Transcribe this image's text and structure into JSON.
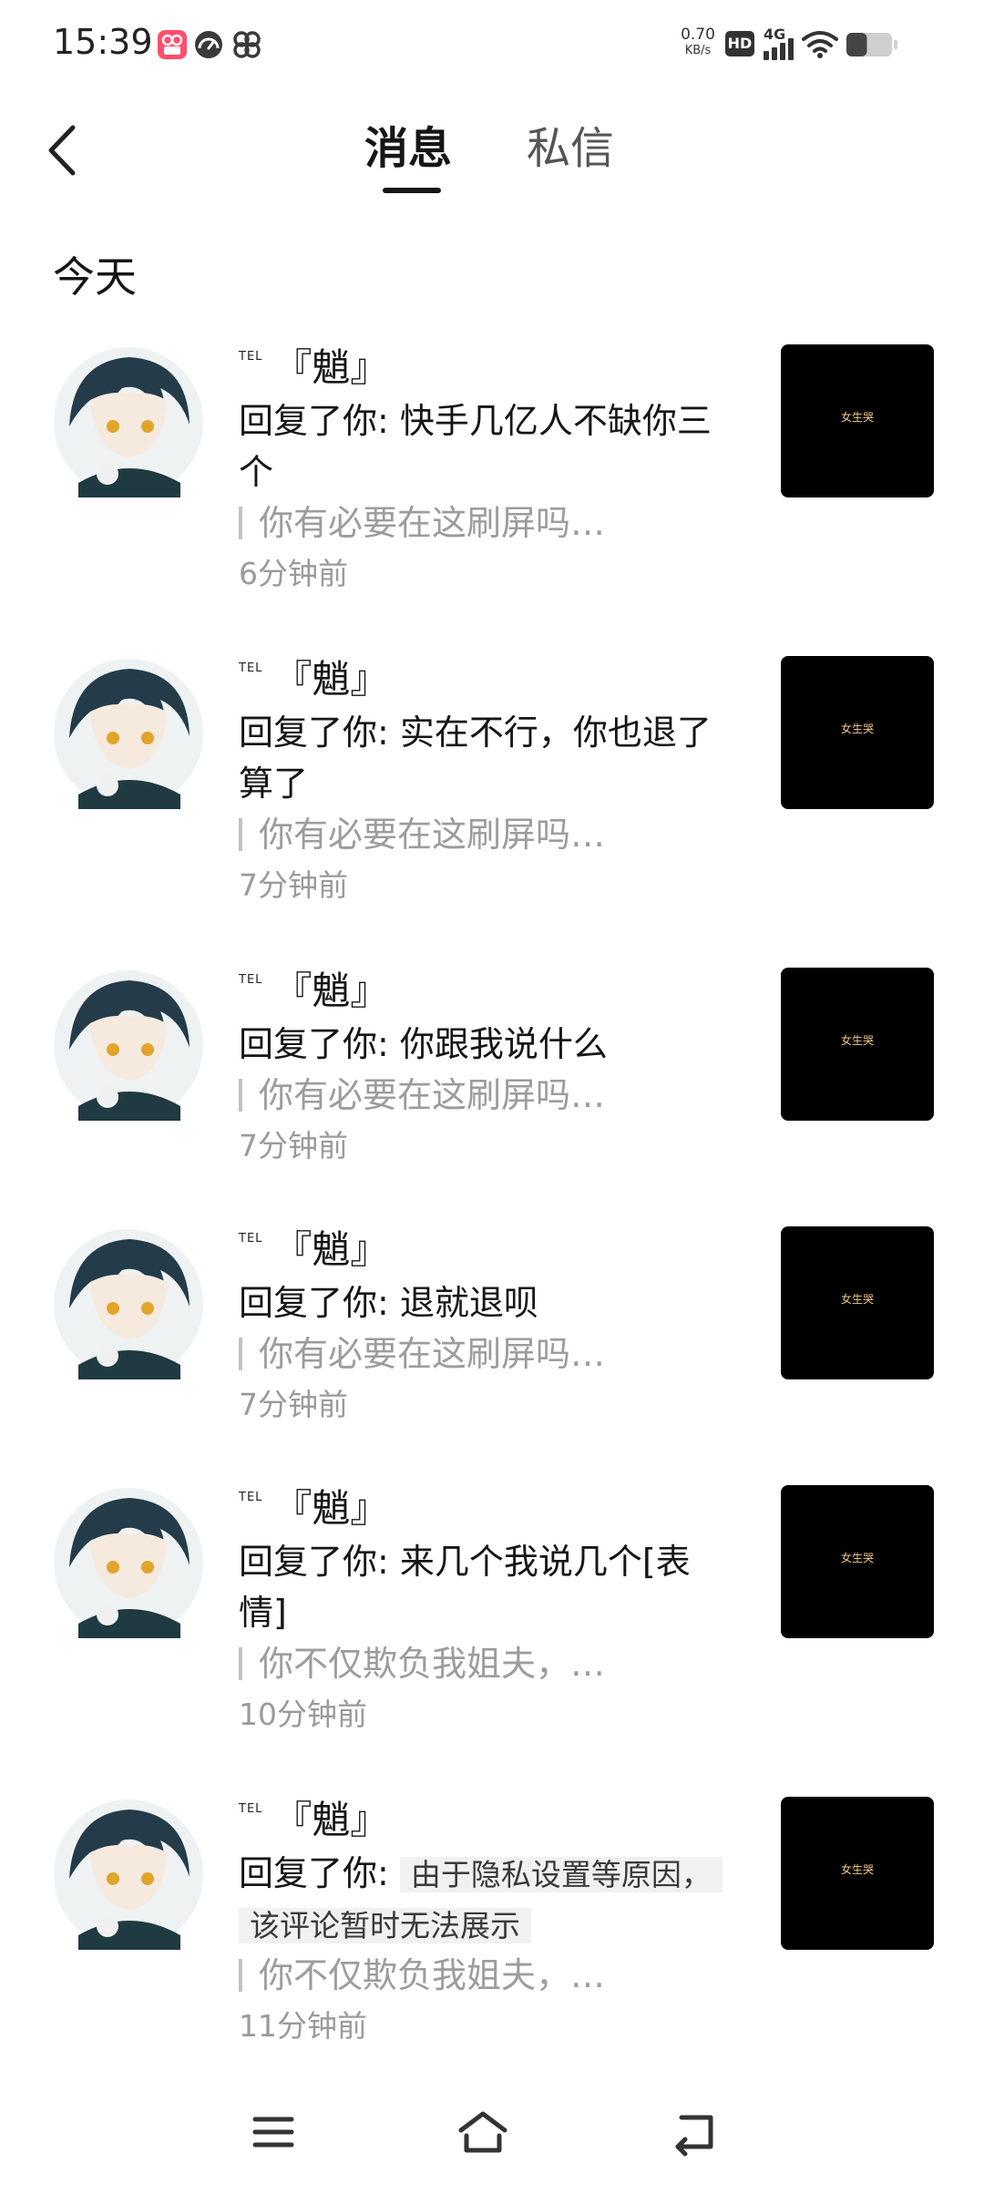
{
  "status_bar": {
    "time": "15:39",
    "net_speed_value": "0.70",
    "net_speed_unit": "KB/s",
    "hd_label": "HD",
    "network_label": "4G",
    "app_icons": [
      "photo-album-app-icon",
      "speedometer-app-icon",
      "pinwheel-app-icon"
    ],
    "battery_level": 0.45
  },
  "header": {
    "tabs": [
      {
        "label": "消息",
        "active": true
      },
      {
        "label": "私信",
        "active": false
      }
    ]
  },
  "section": {
    "title": "今天"
  },
  "messages": [
    {
      "badge": "TEL",
      "user": "『魈』",
      "prefix": "回复了你: ",
      "text": "快手几亿人不缺你三个",
      "quote": "你有必要在这刷屏吗…",
      "time": "6分钟前",
      "thumb_text": "女生哭"
    },
    {
      "badge": "TEL",
      "user": "『魈』",
      "prefix": "回复了你: ",
      "text": "实在不行，你也退了算了",
      "quote": "你有必要在这刷屏吗…",
      "time": "7分钟前",
      "thumb_text": "女生哭"
    },
    {
      "badge": "TEL",
      "user": "『魈』",
      "prefix": "回复了你: ",
      "text": "你跟我说什么",
      "quote": "你有必要在这刷屏吗…",
      "time": "7分钟前",
      "thumb_text": "女生哭"
    },
    {
      "badge": "TEL",
      "user": "『魈』",
      "prefix": "回复了你: ",
      "text": "退就退呗",
      "quote": "你有必要在这刷屏吗…",
      "time": "7分钟前",
      "thumb_text": "女生哭"
    },
    {
      "badge": "TEL",
      "user": "『魈』",
      "prefix": "回复了你: ",
      "text": "来几个我说几个[表情]",
      "quote": "你不仅欺负我姐夫，…",
      "time": "10分钟前",
      "thumb_text": "女生哭"
    },
    {
      "badge": "TEL",
      "user": "『魈』",
      "prefix": "回复了你: ",
      "privacy_note": "由于隐私设置等原因，该评论暂时无法展示",
      "quote": "你不仅欺负我姐夫，…",
      "time": "11分钟前",
      "thumb_text": "女生哭"
    }
  ],
  "nav_bar": {
    "icons": [
      "menu-icon",
      "home-icon",
      "back-return-icon"
    ]
  },
  "colors": {
    "primary_text": "#161616",
    "secondary_text": "#9a9a9a",
    "quote_bar": "#c2c2c2",
    "thumb_background": "#000000",
    "privacy_note_background": "#f1f1f1"
  }
}
